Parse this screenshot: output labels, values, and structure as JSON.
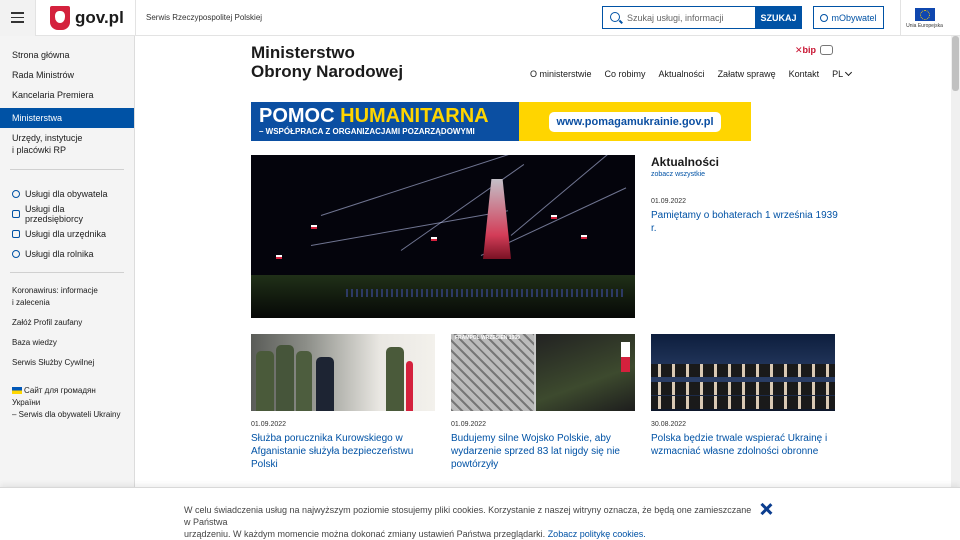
{
  "header": {
    "logo_text": "gov.pl",
    "service_name": "Serwis Rzeczypospolitej Polskiej",
    "search_placeholder": "Szukaj usługi, informacji",
    "search_button": "SZUKAJ",
    "mobywatel_label": "mObywatel",
    "eu_label": "Unia Europejska"
  },
  "sidebar": {
    "main_items": [
      {
        "label": "Strona główna"
      },
      {
        "label": "Rada Ministrów"
      },
      {
        "label": "Kancelaria Premiera"
      },
      {
        "label": "Ministerstwa",
        "active": true
      },
      {
        "label": "Urzędy, instytucje",
        "label2": "i placówki RP"
      }
    ],
    "service_items": [
      {
        "label": "Usługi dla obywatela",
        "icon": "person-icon"
      },
      {
        "label": "Usługi dla przedsiębiorcy",
        "icon": "briefcase-icon"
      },
      {
        "label": "Usługi dla urzędnika",
        "icon": "laptop-icon"
      },
      {
        "label": "Usługi dla rolnika",
        "icon": "farmer-icon"
      }
    ],
    "extra_items": [
      {
        "label": "Koronawirus: informacje",
        "label2": "i zalecenia"
      },
      {
        "label": "Załóż Profil zaufany"
      },
      {
        "label": "Baza wiedzy"
      },
      {
        "label": "Serwis Służby Cywilnej"
      },
      {
        "label": "Сайт для громадян України",
        "label2": "– Serwis dla obywateli Ukrainy"
      }
    ]
  },
  "ministry": {
    "title_line1": "Ministerstwo",
    "title_line2": "Obrony Narodowej",
    "bip": "bip"
  },
  "nav": [
    {
      "label": "O ministerstwie"
    },
    {
      "label": "Co robimy"
    },
    {
      "label": "Aktualności"
    },
    {
      "label": "Załatw sprawę"
    },
    {
      "label": "Kontakt"
    },
    {
      "label": "PL"
    }
  ],
  "banner": {
    "title_part1": "POMOC",
    "title_part2": "HUMANITARNA",
    "subtitle": "– WSPÓŁPRACA Z ORGANIZACJAMI POZARZĄDOWYMI",
    "url": "www.pomagamukrainie.gov.pl"
  },
  "news": {
    "heading": "Aktualności",
    "see_all": "zobacz wszystkie",
    "featured": {
      "date": "01.09.2022",
      "title": "Pamiętamy o bohaterach 1 września 1939 r."
    }
  },
  "cards": [
    {
      "date": "01.09.2022",
      "title": "Służba porucznika Kurowskiego w Afganistanie służyła bezpieczeństwu Polski"
    },
    {
      "date": "01.09.2022",
      "title": "Budujemy silne Wojsko Polskie, aby wydarzenie sprzed 83 lat nigdy się nie powtórzyły",
      "image_caption": "FRAMPOL   WRZESIEŃ 1939"
    },
    {
      "date": "30.08.2022",
      "title": "Polska będzie trwale wspierać Ukrainę i wzmacniać własne zdolności obronne"
    }
  ],
  "cookie": {
    "text_line1": "W celu świadczenia usług na najwyższym poziomie stosujemy pliki cookies. Korzystanie z naszej witryny oznacza, że będą one zamieszczane w Państwa",
    "text_line2": "urządzeniu. W każdym momencie można dokonać zmiany ustawień Państwa przeglądarki.",
    "link": "Zobacz politykę cookies."
  },
  "colors": {
    "primary": "#0052a5",
    "accent_red": "#d4213d",
    "banner_yellow": "#ffd500"
  }
}
